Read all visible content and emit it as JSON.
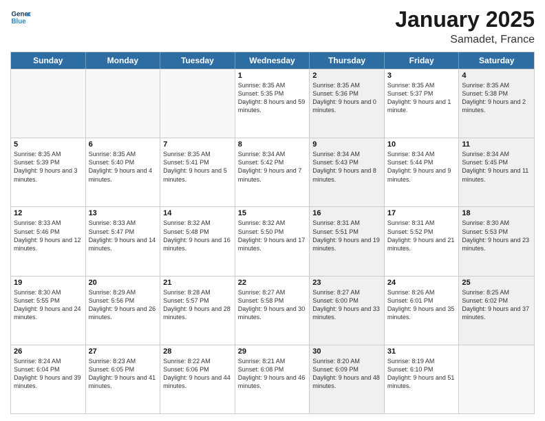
{
  "header": {
    "logo_line1": "General",
    "logo_line2": "Blue",
    "month": "January 2025",
    "location": "Samadet, France"
  },
  "weekdays": [
    "Sunday",
    "Monday",
    "Tuesday",
    "Wednesday",
    "Thursday",
    "Friday",
    "Saturday"
  ],
  "rows": [
    [
      {
        "day": "",
        "sunrise": "",
        "sunset": "",
        "daylight": "",
        "shaded": false,
        "empty": true
      },
      {
        "day": "",
        "sunrise": "",
        "sunset": "",
        "daylight": "",
        "shaded": false,
        "empty": true
      },
      {
        "day": "",
        "sunrise": "",
        "sunset": "",
        "daylight": "",
        "shaded": false,
        "empty": true
      },
      {
        "day": "1",
        "sunrise": "Sunrise: 8:35 AM",
        "sunset": "Sunset: 5:35 PM",
        "daylight": "Daylight: 8 hours and 59 minutes.",
        "shaded": false,
        "empty": false
      },
      {
        "day": "2",
        "sunrise": "Sunrise: 8:35 AM",
        "sunset": "Sunset: 5:36 PM",
        "daylight": "Daylight: 9 hours and 0 minutes.",
        "shaded": true,
        "empty": false
      },
      {
        "day": "3",
        "sunrise": "Sunrise: 8:35 AM",
        "sunset": "Sunset: 5:37 PM",
        "daylight": "Daylight: 9 hours and 1 minute.",
        "shaded": false,
        "empty": false
      },
      {
        "day": "4",
        "sunrise": "Sunrise: 8:35 AM",
        "sunset": "Sunset: 5:38 PM",
        "daylight": "Daylight: 9 hours and 2 minutes.",
        "shaded": true,
        "empty": false
      }
    ],
    [
      {
        "day": "5",
        "sunrise": "Sunrise: 8:35 AM",
        "sunset": "Sunset: 5:39 PM",
        "daylight": "Daylight: 9 hours and 3 minutes.",
        "shaded": false,
        "empty": false
      },
      {
        "day": "6",
        "sunrise": "Sunrise: 8:35 AM",
        "sunset": "Sunset: 5:40 PM",
        "daylight": "Daylight: 9 hours and 4 minutes.",
        "shaded": false,
        "empty": false
      },
      {
        "day": "7",
        "sunrise": "Sunrise: 8:35 AM",
        "sunset": "Sunset: 5:41 PM",
        "daylight": "Daylight: 9 hours and 5 minutes.",
        "shaded": false,
        "empty": false
      },
      {
        "day": "8",
        "sunrise": "Sunrise: 8:34 AM",
        "sunset": "Sunset: 5:42 PM",
        "daylight": "Daylight: 9 hours and 7 minutes.",
        "shaded": false,
        "empty": false
      },
      {
        "day": "9",
        "sunrise": "Sunrise: 8:34 AM",
        "sunset": "Sunset: 5:43 PM",
        "daylight": "Daylight: 9 hours and 8 minutes.",
        "shaded": true,
        "empty": false
      },
      {
        "day": "10",
        "sunrise": "Sunrise: 8:34 AM",
        "sunset": "Sunset: 5:44 PM",
        "daylight": "Daylight: 9 hours and 9 minutes.",
        "shaded": false,
        "empty": false
      },
      {
        "day": "11",
        "sunrise": "Sunrise: 8:34 AM",
        "sunset": "Sunset: 5:45 PM",
        "daylight": "Daylight: 9 hours and 11 minutes.",
        "shaded": true,
        "empty": false
      }
    ],
    [
      {
        "day": "12",
        "sunrise": "Sunrise: 8:33 AM",
        "sunset": "Sunset: 5:46 PM",
        "daylight": "Daylight: 9 hours and 12 minutes.",
        "shaded": false,
        "empty": false
      },
      {
        "day": "13",
        "sunrise": "Sunrise: 8:33 AM",
        "sunset": "Sunset: 5:47 PM",
        "daylight": "Daylight: 9 hours and 14 minutes.",
        "shaded": false,
        "empty": false
      },
      {
        "day": "14",
        "sunrise": "Sunrise: 8:32 AM",
        "sunset": "Sunset: 5:48 PM",
        "daylight": "Daylight: 9 hours and 16 minutes.",
        "shaded": false,
        "empty": false
      },
      {
        "day": "15",
        "sunrise": "Sunrise: 8:32 AM",
        "sunset": "Sunset: 5:50 PM",
        "daylight": "Daylight: 9 hours and 17 minutes.",
        "shaded": false,
        "empty": false
      },
      {
        "day": "16",
        "sunrise": "Sunrise: 8:31 AM",
        "sunset": "Sunset: 5:51 PM",
        "daylight": "Daylight: 9 hours and 19 minutes.",
        "shaded": true,
        "empty": false
      },
      {
        "day": "17",
        "sunrise": "Sunrise: 8:31 AM",
        "sunset": "Sunset: 5:52 PM",
        "daylight": "Daylight: 9 hours and 21 minutes.",
        "shaded": false,
        "empty": false
      },
      {
        "day": "18",
        "sunrise": "Sunrise: 8:30 AM",
        "sunset": "Sunset: 5:53 PM",
        "daylight": "Daylight: 9 hours and 23 minutes.",
        "shaded": true,
        "empty": false
      }
    ],
    [
      {
        "day": "19",
        "sunrise": "Sunrise: 8:30 AM",
        "sunset": "Sunset: 5:55 PM",
        "daylight": "Daylight: 9 hours and 24 minutes.",
        "shaded": false,
        "empty": false
      },
      {
        "day": "20",
        "sunrise": "Sunrise: 8:29 AM",
        "sunset": "Sunset: 5:56 PM",
        "daylight": "Daylight: 9 hours and 26 minutes.",
        "shaded": false,
        "empty": false
      },
      {
        "day": "21",
        "sunrise": "Sunrise: 8:28 AM",
        "sunset": "Sunset: 5:57 PM",
        "daylight": "Daylight: 9 hours and 28 minutes.",
        "shaded": false,
        "empty": false
      },
      {
        "day": "22",
        "sunrise": "Sunrise: 8:27 AM",
        "sunset": "Sunset: 5:58 PM",
        "daylight": "Daylight: 9 hours and 30 minutes.",
        "shaded": false,
        "empty": false
      },
      {
        "day": "23",
        "sunrise": "Sunrise: 8:27 AM",
        "sunset": "Sunset: 6:00 PM",
        "daylight": "Daylight: 9 hours and 33 minutes.",
        "shaded": true,
        "empty": false
      },
      {
        "day": "24",
        "sunrise": "Sunrise: 8:26 AM",
        "sunset": "Sunset: 6:01 PM",
        "daylight": "Daylight: 9 hours and 35 minutes.",
        "shaded": false,
        "empty": false
      },
      {
        "day": "25",
        "sunrise": "Sunrise: 8:25 AM",
        "sunset": "Sunset: 6:02 PM",
        "daylight": "Daylight: 9 hours and 37 minutes.",
        "shaded": true,
        "empty": false
      }
    ],
    [
      {
        "day": "26",
        "sunrise": "Sunrise: 8:24 AM",
        "sunset": "Sunset: 6:04 PM",
        "daylight": "Daylight: 9 hours and 39 minutes.",
        "shaded": false,
        "empty": false
      },
      {
        "day": "27",
        "sunrise": "Sunrise: 8:23 AM",
        "sunset": "Sunset: 6:05 PM",
        "daylight": "Daylight: 9 hours and 41 minutes.",
        "shaded": false,
        "empty": false
      },
      {
        "day": "28",
        "sunrise": "Sunrise: 8:22 AM",
        "sunset": "Sunset: 6:06 PM",
        "daylight": "Daylight: 9 hours and 44 minutes.",
        "shaded": false,
        "empty": false
      },
      {
        "day": "29",
        "sunrise": "Sunrise: 8:21 AM",
        "sunset": "Sunset: 6:08 PM",
        "daylight": "Daylight: 9 hours and 46 minutes.",
        "shaded": false,
        "empty": false
      },
      {
        "day": "30",
        "sunrise": "Sunrise: 8:20 AM",
        "sunset": "Sunset: 6:09 PM",
        "daylight": "Daylight: 9 hours and 48 minutes.",
        "shaded": true,
        "empty": false
      },
      {
        "day": "31",
        "sunrise": "Sunrise: 8:19 AM",
        "sunset": "Sunset: 6:10 PM",
        "daylight": "Daylight: 9 hours and 51 minutes.",
        "shaded": false,
        "empty": false
      },
      {
        "day": "",
        "sunrise": "",
        "sunset": "",
        "daylight": "",
        "shaded": true,
        "empty": true
      }
    ]
  ]
}
